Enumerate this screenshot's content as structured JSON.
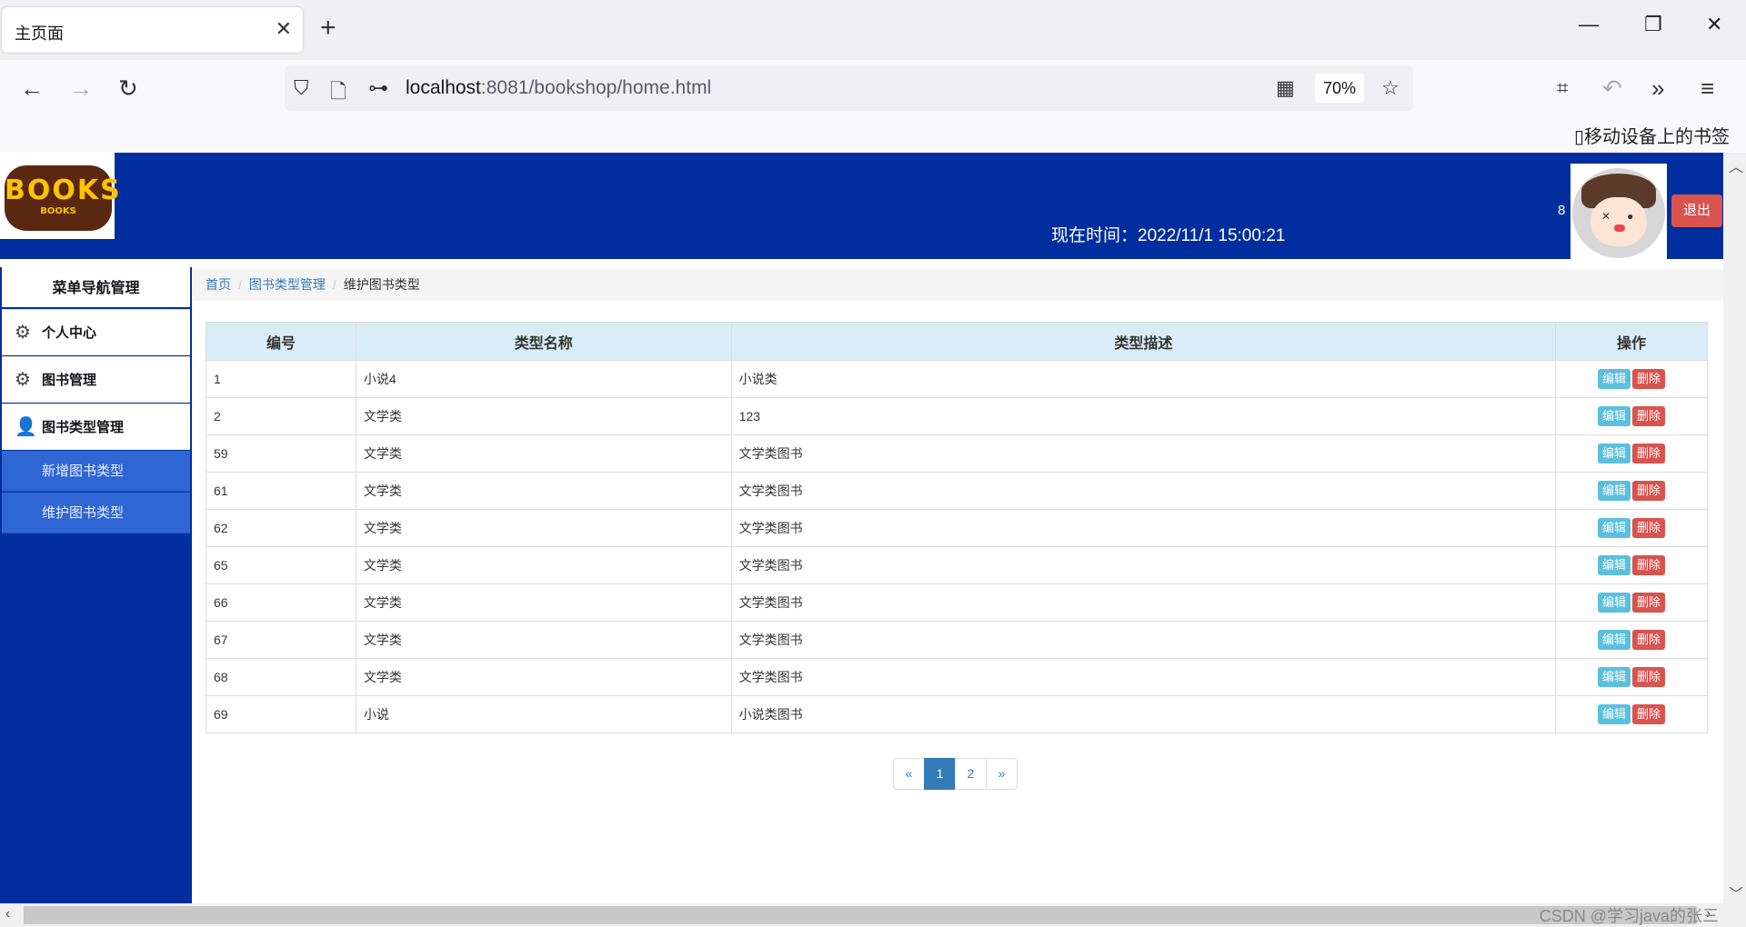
{
  "browser": {
    "tab_title": "主页面",
    "tab_close": "✕",
    "new_tab": "+",
    "url_host": "localhost",
    "url_rest": ":8081/bookshop/home.html",
    "zoom": "70%",
    "bookmark_item": "移动设备上的书签"
  },
  "header": {
    "logo_big": "BOOKS",
    "logo_small": "BOOKS",
    "time_text": "现在时间：2022/11/1 15:00:21",
    "user_count": "8",
    "logout_label": "退出"
  },
  "sidebar": {
    "title": "菜单导航管理",
    "items": [
      {
        "label": "个人中心",
        "icon": "gear-icon"
      },
      {
        "label": "图书管理",
        "icon": "gear-icon"
      },
      {
        "label": "图书类型管理",
        "icon": "user-icon"
      }
    ],
    "subitems": [
      {
        "label": "新增图书类型"
      },
      {
        "label": "维护图书类型"
      }
    ]
  },
  "breadcrumb": {
    "home": "首页",
    "section": "图书类型管理",
    "current": "维护图书类型",
    "separator": "/"
  },
  "table": {
    "headers": [
      "编号",
      "类型名称",
      "类型描述",
      "操作"
    ],
    "edit_label": "编辑",
    "delete_label": "删除",
    "rows": [
      {
        "id": "1",
        "name": "小说4",
        "desc": "小说类"
      },
      {
        "id": "2",
        "name": "文学类",
        "desc": "123"
      },
      {
        "id": "59",
        "name": "文学类",
        "desc": "文学类图书"
      },
      {
        "id": "61",
        "name": "文学类",
        "desc": "文学类图书"
      },
      {
        "id": "62",
        "name": "文学类",
        "desc": "文学类图书"
      },
      {
        "id": "65",
        "name": "文学类",
        "desc": "文学类图书"
      },
      {
        "id": "66",
        "name": "文学类",
        "desc": "文学类图书"
      },
      {
        "id": "67",
        "name": "文学类",
        "desc": "文学类图书"
      },
      {
        "id": "68",
        "name": "文学类",
        "desc": "文学类图书"
      },
      {
        "id": "69",
        "name": "小说",
        "desc": "小说类图书"
      }
    ]
  },
  "pagination": {
    "prev": "«",
    "pages": [
      "1",
      "2"
    ],
    "active": "1",
    "next": "»"
  },
  "watermark": "CSDN @学习java的张三",
  "colors": {
    "header_bg": "#002e9e",
    "sidebar_sub_bg": "#3066d3",
    "table_head_bg": "#d9edf7",
    "edit_btn": "#5bc0de",
    "delete_btn": "#d9534f",
    "pager_active": "#337ab7"
  }
}
